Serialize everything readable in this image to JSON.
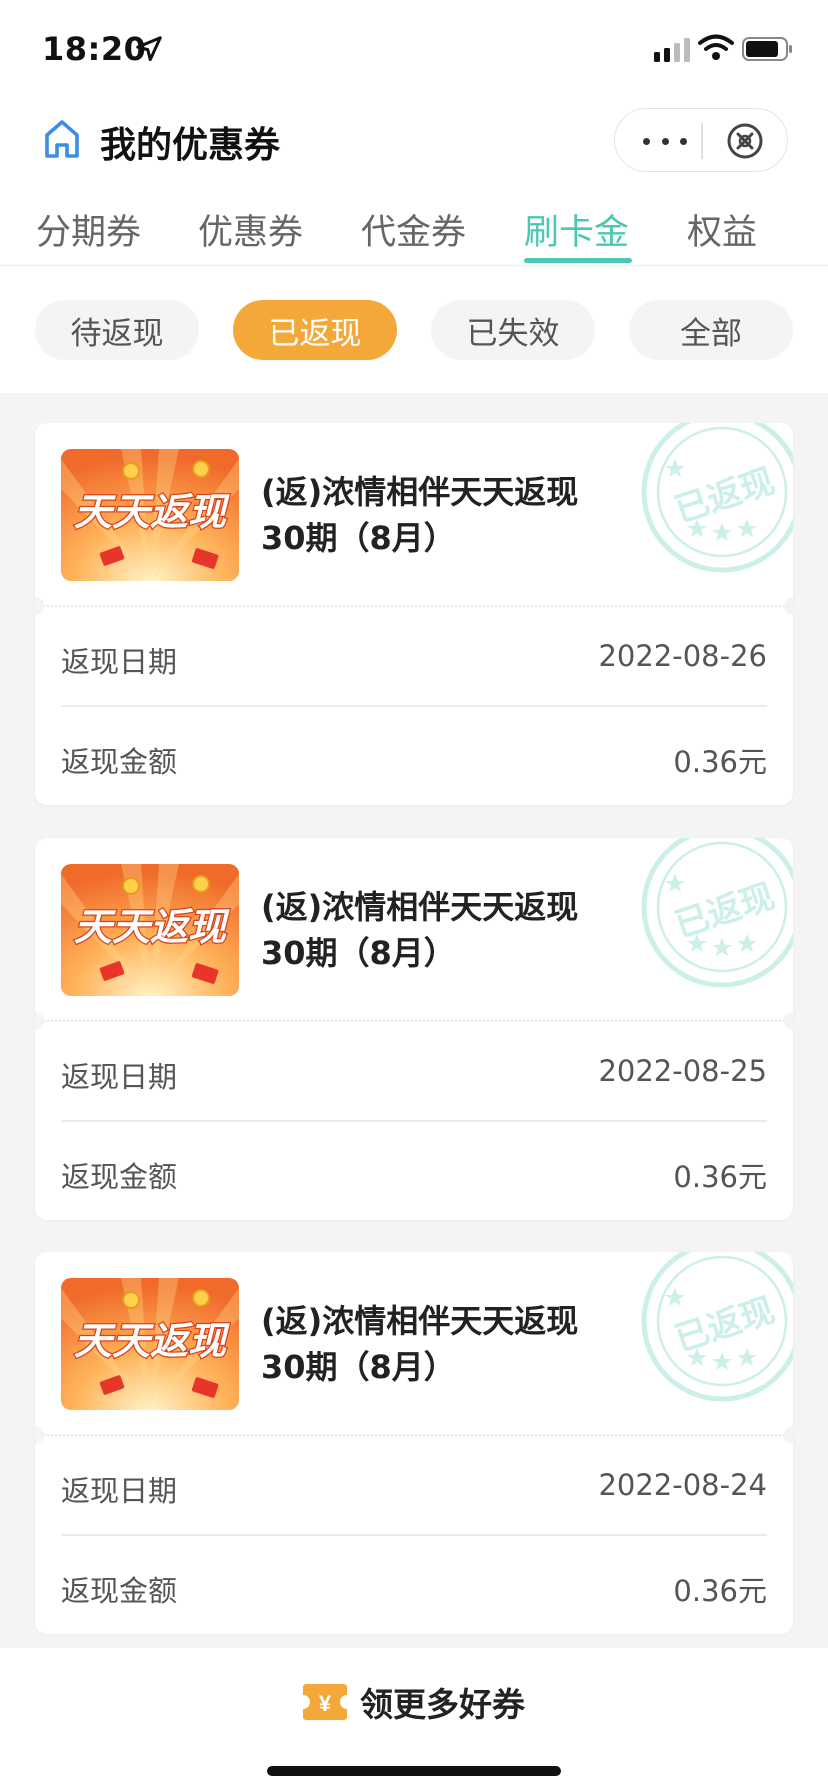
{
  "status_bar": {
    "time": "18:20"
  },
  "nav": {
    "title": "我的优惠券"
  },
  "main_tabs": [
    "分期券",
    "优惠券",
    "代金券",
    "刷卡金",
    "权益"
  ],
  "filters": [
    "待返现",
    "已返现",
    "已失效",
    "全部"
  ],
  "coupon_cards": [
    {
      "title_line1": "(返)浓情相伴天天返现",
      "title_line2": "30期（8月）",
      "thumb_text": "天天返现",
      "stamp_text": "已返现",
      "date_label": "返现日期",
      "date": "2022-08-26",
      "amount_label": "返现金额",
      "amount": "0.36元"
    },
    {
      "title_line1": "(返)浓情相伴天天返现",
      "title_line2": "30期（8月）",
      "thumb_text": "天天返现",
      "stamp_text": "已返现",
      "date_label": "返现日期",
      "date": "2022-08-25",
      "amount_label": "返现金额",
      "amount": "0.36元"
    },
    {
      "title_line1": "(返)浓情相伴天天返现",
      "title_line2": "30期（8月）",
      "thumb_text": "天天返现",
      "stamp_text": "已返现",
      "date_label": "返现日期",
      "date": "2022-08-24",
      "amount_label": "返现金额",
      "amount": "0.36元"
    }
  ],
  "bottom": {
    "more_label": "领更多好券",
    "yen_symbol": "¥"
  },
  "colors": {
    "accent": "#4cc7b4",
    "active_chip": "#f4a83a",
    "stamp": "#4cc7b4"
  },
  "active": {
    "main_tab": "刷卡金",
    "filter": "已返现"
  }
}
